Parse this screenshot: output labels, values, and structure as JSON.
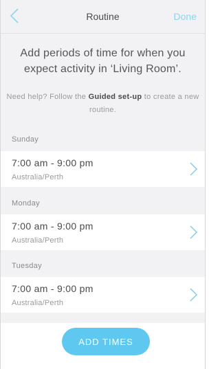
{
  "nav": {
    "title": "Routine",
    "done_label": "Done"
  },
  "intro": "Add periods of time for when you expect activity in ‘Living Room’.",
  "help": {
    "before": "Need help? Follow the ",
    "link": "Guided set-up",
    "after": " to create a new routine."
  },
  "days": [
    {
      "name": "Sunday",
      "time": "7:00 am - 9:00 pm",
      "zone": "Australia/Perth"
    },
    {
      "name": "Monday",
      "time": "7:00 am - 9:00 pm",
      "zone": "Australia/Perth"
    },
    {
      "name": "Tuesday",
      "time": "7:00 am - 9:00 pm",
      "zone": "Australia/Perth"
    }
  ],
  "add_button_label": "ADD TIMES",
  "colors": {
    "accent": "#5ec8f0",
    "accent_light": "#8fd3f0",
    "background": "#f2f2f4"
  },
  "icons": {
    "back": "chevron-left-icon",
    "row": "chevron-right-icon"
  }
}
